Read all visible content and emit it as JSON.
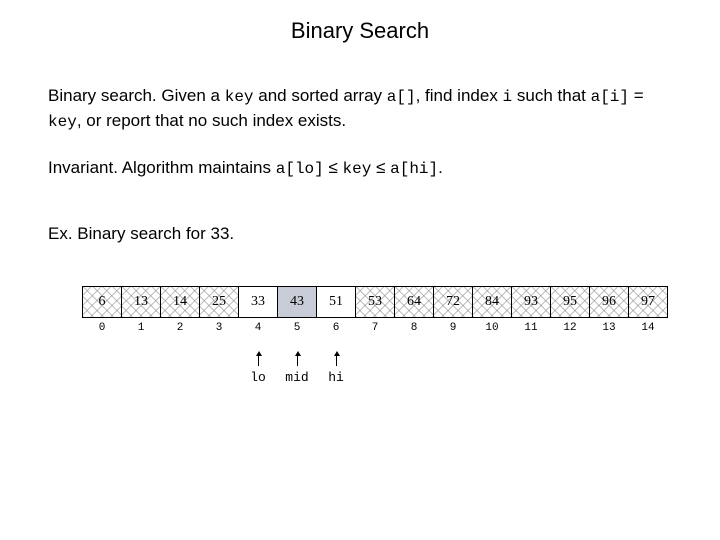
{
  "title": "Binary Search",
  "para1": {
    "lead": "Binary search.",
    "t1": " Given a ",
    "c1": "key",
    "t2": " and sorted array ",
    "c2": "a[]",
    "t3": ", find index ",
    "c3": "i",
    "t4": " such that ",
    "c4": "a[i]",
    "t5": " = ",
    "c5": "key",
    "t6": ", or report that no such index exists."
  },
  "para2": {
    "lead": "Invariant.",
    "t1": " Algorithm maintains ",
    "c1": "a[lo]",
    "le1": " ≤ ",
    "c2": "key",
    "le2": " ≤ ",
    "c3": "a[hi]",
    "t2": "."
  },
  "para3": {
    "lead": "Ex.",
    "t1": " Binary search for 33."
  },
  "array": {
    "values": [
      "6",
      "13",
      "14",
      "25",
      "33",
      "43",
      "51",
      "53",
      "64",
      "72",
      "84",
      "93",
      "95",
      "96",
      "97"
    ],
    "indices": [
      "0",
      "1",
      "2",
      "3",
      "4",
      "5",
      "6",
      "7",
      "8",
      "9",
      "10",
      "11",
      "12",
      "13",
      "14"
    ],
    "hatched": [
      true,
      true,
      true,
      true,
      false,
      false,
      false,
      true,
      true,
      true,
      true,
      true,
      true,
      true,
      true
    ],
    "selected_index": 5,
    "pointers": {
      "4": "lo",
      "5": "mid",
      "6": "hi"
    }
  }
}
